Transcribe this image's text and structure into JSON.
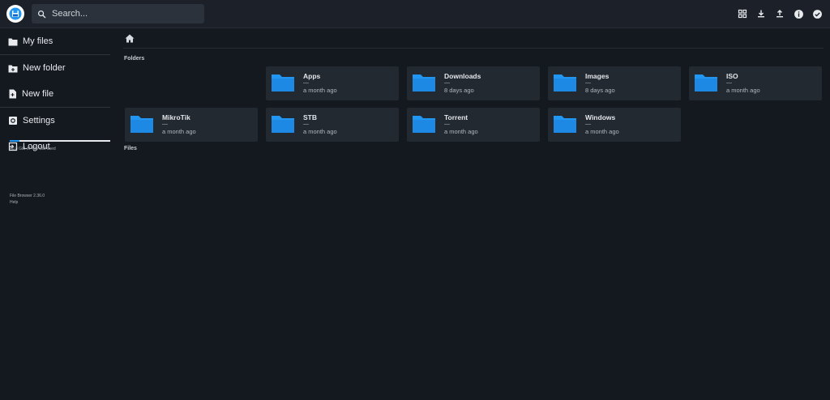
{
  "header": {
    "search_placeholder": "Search...",
    "actions": [
      "grid-view-icon",
      "download-icon",
      "upload-icon",
      "info-icon",
      "select-check-icon"
    ]
  },
  "sidebar": {
    "items": [
      {
        "label": "My files",
        "icon": "folder-icon"
      },
      {
        "label": "New folder",
        "icon": "new-folder-icon"
      },
      {
        "label": "New file",
        "icon": "new-file-icon"
      },
      {
        "label": "Settings",
        "icon": "settings-icon"
      },
      {
        "label": "Logout",
        "icon": "logout-icon"
      }
    ],
    "usage_text": "40.8 GiB of 406 GiB used",
    "usage_fraction": 0.1,
    "version": "File Browser 2.36.0",
    "help": "Help"
  },
  "main": {
    "folders_title": "Folders",
    "files_title": "Files",
    "folders": [
      {
        "name": "Apps",
        "size": "—",
        "modified": "a month ago"
      },
      {
        "name": "Downloads",
        "size": "—",
        "modified": "8 days ago"
      },
      {
        "name": "Images",
        "size": "—",
        "modified": "8 days ago"
      },
      {
        "name": "ISO",
        "size": "—",
        "modified": "a month ago"
      },
      {
        "name": "MikroTik",
        "size": "—",
        "modified": "a month ago"
      },
      {
        "name": "STB",
        "size": "—",
        "modified": "a month ago"
      },
      {
        "name": "Torrent",
        "size": "—",
        "modified": "a month ago"
      },
      {
        "name": "Windows",
        "size": "—",
        "modified": "a month ago"
      }
    ]
  },
  "colors": {
    "accent": "#2196f3",
    "background": "#141920",
    "card": "#232931"
  }
}
